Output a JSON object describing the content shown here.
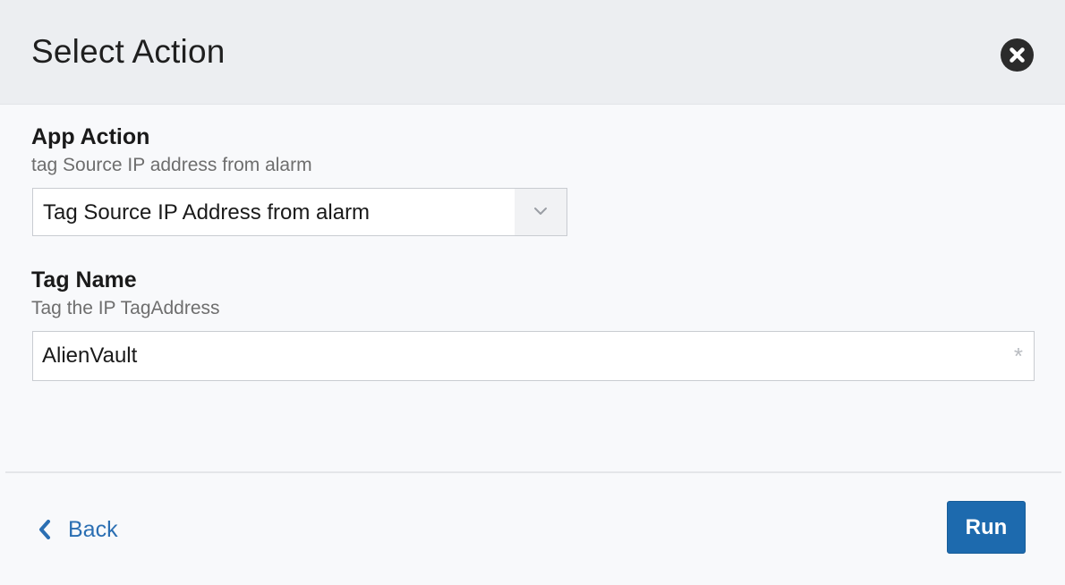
{
  "dialog": {
    "title": "Select Action",
    "close_icon": "close-circle-icon"
  },
  "app_action": {
    "label": "App Action",
    "hint": "tag Source IP address from alarm",
    "selected_value": "Tag Source IP Address from alarm",
    "arrow_icon": "chevron-down-icon"
  },
  "tag_name": {
    "label": "Tag Name",
    "hint": "Tag the IP TagAddress",
    "value": "AlienVault",
    "required_mark": "*"
  },
  "footer": {
    "back_label": "Back",
    "back_icon": "chevron-left-icon",
    "run_label": "Run"
  },
  "colors": {
    "header_bg": "#eceef1",
    "primary": "#1d6aae",
    "link": "#2b6fb3"
  }
}
